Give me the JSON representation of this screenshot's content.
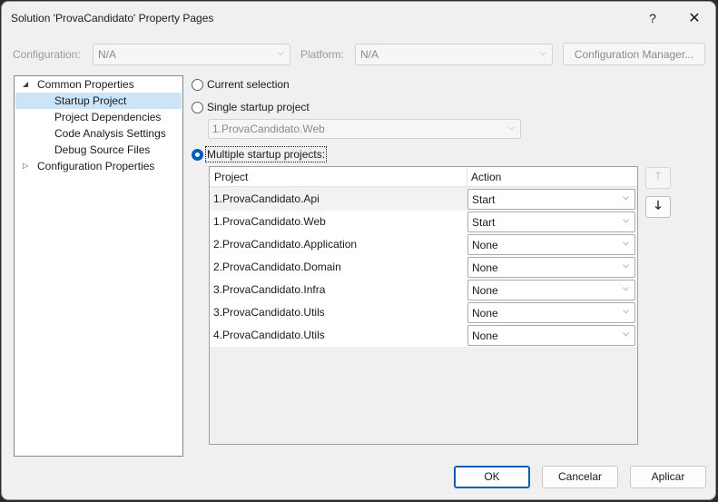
{
  "titlebar": {
    "title": "Solution 'ProvaCandidato' Property Pages",
    "help": "?",
    "close": "✕"
  },
  "config": {
    "configuration_label": "Configuration:",
    "configuration_value": "N/A",
    "platform_label": "Platform:",
    "platform_value": "N/A",
    "manager_button": "Configuration Manager..."
  },
  "tree": {
    "items": [
      {
        "label": "Common Properties",
        "expander": "◢"
      },
      {
        "label": "Startup Project"
      },
      {
        "label": "Project Dependencies"
      },
      {
        "label": "Code Analysis Settings"
      },
      {
        "label": "Debug Source Files"
      },
      {
        "label": "Configuration Properties",
        "expander": "▷"
      }
    ],
    "selected": "Startup Project"
  },
  "startup": {
    "current_selection": "Current selection",
    "single_startup": "Single startup project",
    "single_value": "1.ProvaCandidato.Web",
    "multiple_startup": "Multiple startup projects:",
    "selected_option": "multiple"
  },
  "grid": {
    "col_project": "Project",
    "col_action": "Action",
    "rows": [
      {
        "project": "1.ProvaCandidato.Api",
        "action": "Start"
      },
      {
        "project": "1.ProvaCandidato.Web",
        "action": "Start"
      },
      {
        "project": "2.ProvaCandidato.Application",
        "action": "None"
      },
      {
        "project": "2.ProvaCandidato.Domain",
        "action": "None"
      },
      {
        "project": "3.ProvaCandidato.Infra",
        "action": "None"
      },
      {
        "project": "3.ProvaCandidato.Utils",
        "action": "None"
      },
      {
        "project": "4.ProvaCandidato.Utils",
        "action": "None"
      }
    ]
  },
  "move": {
    "up_icon": "arrow-up-icon",
    "down_icon": "arrow-down-icon"
  },
  "buttons": {
    "ok": "OK",
    "cancel": "Cancelar",
    "apply": "Aplicar"
  },
  "colors": {
    "accent": "#005fb8",
    "selection": "#cce4f7"
  }
}
